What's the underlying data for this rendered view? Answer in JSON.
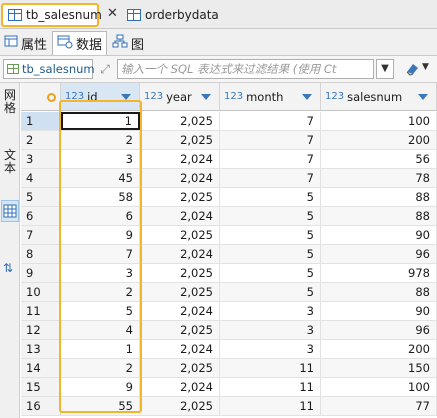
{
  "editor_tabs": [
    {
      "label": "tb_salesnum",
      "active": true,
      "closable": true
    },
    {
      "label": "orderbydata",
      "active": false,
      "closable": false
    }
  ],
  "view_tabs": [
    {
      "label": "属性",
      "icon": "properties-icon"
    },
    {
      "label": "数据",
      "icon": "data-icon",
      "active": true
    },
    {
      "label": "图",
      "icon": "diagram-icon"
    }
  ],
  "filter_bar": {
    "table_name": "tb_salesnum",
    "placeholder": "输入一个 SQL 表达式来过滤结果 (使用 Ct"
  },
  "side_panel": {
    "grid_label": "网格",
    "text_label": "文本"
  },
  "columns": [
    {
      "type": "123",
      "name": "id"
    },
    {
      "type": "123",
      "name": "year"
    },
    {
      "type": "123",
      "name": "month"
    },
    {
      "type": "123",
      "name": "salesnum"
    }
  ],
  "rows": [
    {
      "n": "1",
      "id": "1",
      "year": "2,025",
      "month": "7",
      "salesnum": "100"
    },
    {
      "n": "2",
      "id": "2",
      "year": "2,025",
      "month": "7",
      "salesnum": "200"
    },
    {
      "n": "3",
      "id": "3",
      "year": "2,024",
      "month": "7",
      "salesnum": "56"
    },
    {
      "n": "4",
      "id": "45",
      "year": "2,024",
      "month": "7",
      "salesnum": "78"
    },
    {
      "n": "5",
      "id": "58",
      "year": "2,025",
      "month": "5",
      "salesnum": "88"
    },
    {
      "n": "6",
      "id": "6",
      "year": "2,024",
      "month": "5",
      "salesnum": "88"
    },
    {
      "n": "7",
      "id": "9",
      "year": "2,025",
      "month": "5",
      "salesnum": "90"
    },
    {
      "n": "8",
      "id": "7",
      "year": "2,024",
      "month": "5",
      "salesnum": "96"
    },
    {
      "n": "9",
      "id": "3",
      "year": "2,025",
      "month": "5",
      "salesnum": "978"
    },
    {
      "n": "10",
      "id": "2",
      "year": "2,025",
      "month": "5",
      "salesnum": "88"
    },
    {
      "n": "11",
      "id": "5",
      "year": "2,024",
      "month": "3",
      "salesnum": "90"
    },
    {
      "n": "12",
      "id": "4",
      "year": "2,025",
      "month": "3",
      "salesnum": "96"
    },
    {
      "n": "13",
      "id": "1",
      "year": "2,024",
      "month": "3",
      "salesnum": "200"
    },
    {
      "n": "14",
      "id": "2",
      "year": "2,025",
      "month": "11",
      "salesnum": "150"
    },
    {
      "n": "15",
      "id": "9",
      "year": "2,024",
      "month": "11",
      "salesnum": "100"
    },
    {
      "n": "16",
      "id": "55",
      "year": "2,025",
      "month": "11",
      "salesnum": "77"
    }
  ]
}
